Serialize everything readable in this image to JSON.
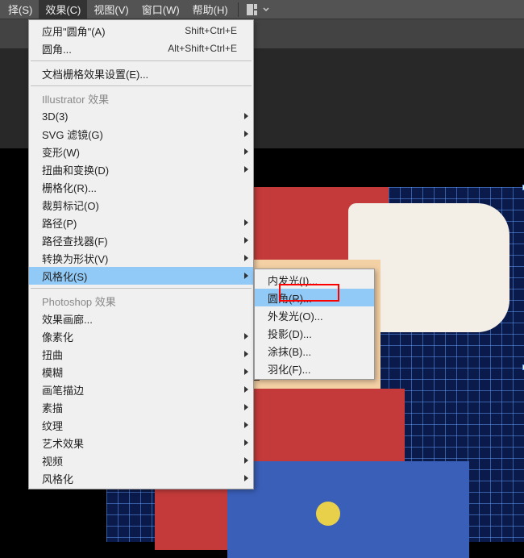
{
  "menubar": {
    "items": [
      {
        "label": "择(S)"
      },
      {
        "label": "效果(C)"
      },
      {
        "label": "视图(V)"
      },
      {
        "label": "窗口(W)"
      },
      {
        "label": "帮助(H)"
      }
    ]
  },
  "effectsMenu": {
    "items": [
      {
        "label": "应用\"圆角\"(A)",
        "shortcut": "Shift+Ctrl+E"
      },
      {
        "label": "圆角...",
        "shortcut": "Alt+Shift+Ctrl+E"
      },
      {
        "type": "sep"
      },
      {
        "label": "文档栅格效果设置(E)..."
      },
      {
        "type": "sep"
      },
      {
        "label": "Illustrator 效果",
        "disabled": true
      },
      {
        "label": "3D(3)",
        "submenu": true
      },
      {
        "label": "SVG 滤镜(G)",
        "submenu": true
      },
      {
        "label": "变形(W)",
        "submenu": true
      },
      {
        "label": "扭曲和变换(D)",
        "submenu": true
      },
      {
        "label": "栅格化(R)..."
      },
      {
        "label": "裁剪标记(O)"
      },
      {
        "label": "路径(P)",
        "submenu": true
      },
      {
        "label": "路径查找器(F)",
        "submenu": true
      },
      {
        "label": "转换为形状(V)",
        "submenu": true
      },
      {
        "label": "风格化(S)",
        "submenu": true,
        "highlight": true
      },
      {
        "type": "sep"
      },
      {
        "label": "Photoshop 效果",
        "disabled": true
      },
      {
        "label": "效果画廊..."
      },
      {
        "label": "像素化",
        "submenu": true
      },
      {
        "label": "扭曲",
        "submenu": true
      },
      {
        "label": "模糊",
        "submenu": true
      },
      {
        "label": "画笔描边",
        "submenu": true
      },
      {
        "label": "素描",
        "submenu": true
      },
      {
        "label": "纹理",
        "submenu": true
      },
      {
        "label": "艺术效果",
        "submenu": true
      },
      {
        "label": "视频",
        "submenu": true
      },
      {
        "label": "风格化",
        "submenu": true
      }
    ]
  },
  "stylizeSubmenu": {
    "items": [
      {
        "label": "内发光(I)..."
      },
      {
        "label": "圆角(R)...",
        "highlight": true,
        "annotated": true
      },
      {
        "label": "外发光(O)..."
      },
      {
        "label": "投影(D)..."
      },
      {
        "label": "涂抹(B)..."
      },
      {
        "label": "羽化(F)..."
      }
    ]
  }
}
